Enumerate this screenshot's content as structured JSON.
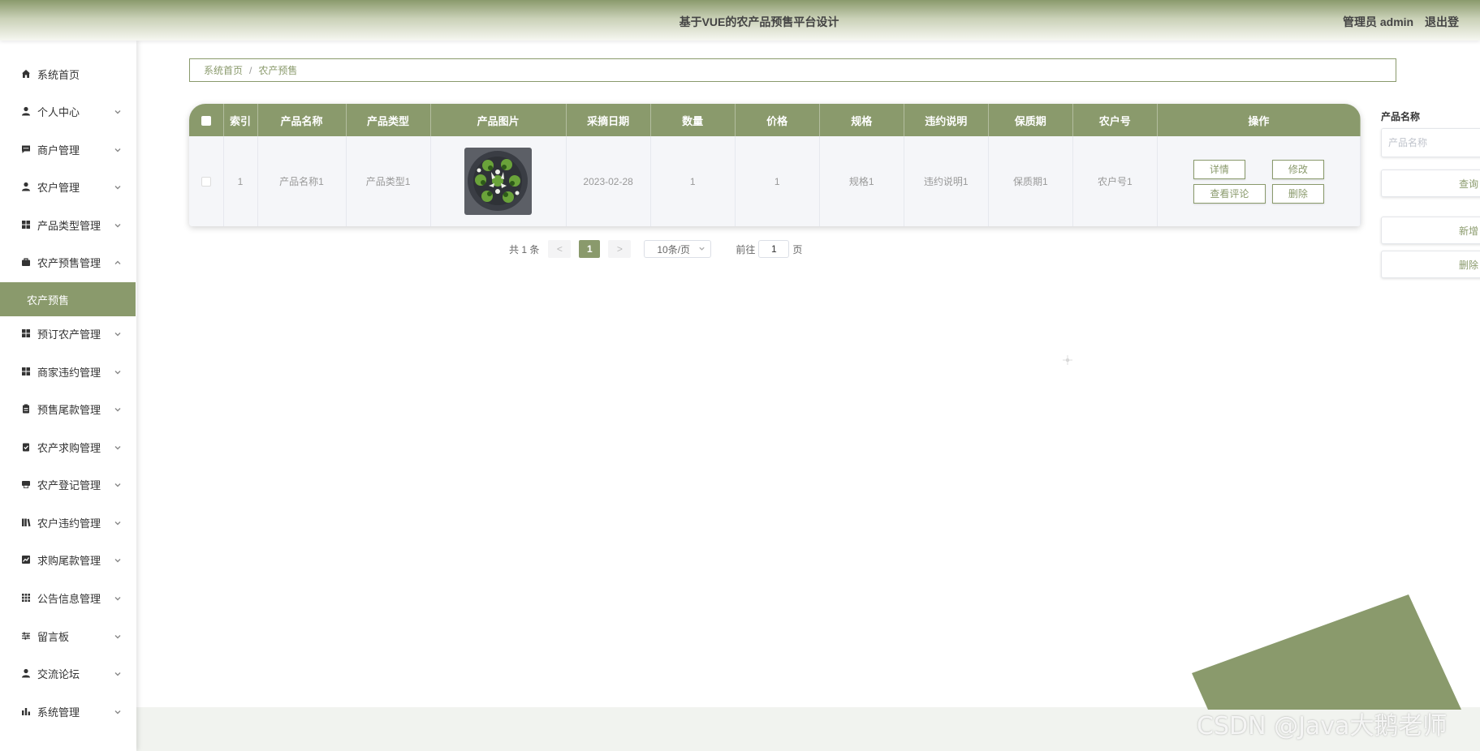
{
  "header": {
    "title": "基于VUE的农产品预售平台设计",
    "user_label": "管理员 admin",
    "logout_label": "退出登"
  },
  "sidebar": {
    "items": [
      {
        "label": "系统首页",
        "icon": "home-icon"
      },
      {
        "label": "个人中心",
        "icon": "user-icon"
      },
      {
        "label": "商户管理",
        "icon": "chat-icon"
      },
      {
        "label": "农户管理",
        "icon": "user-icon"
      },
      {
        "label": "产品类型管理",
        "icon": "grid-icon"
      },
      {
        "label": "农产预售管理",
        "icon": "briefcase-icon"
      },
      {
        "label": "预订农产管理",
        "icon": "grid-icon"
      },
      {
        "label": "商家违约管理",
        "icon": "grid-icon"
      },
      {
        "label": "预售尾款管理",
        "icon": "clipboard-icon"
      },
      {
        "label": "农产求购管理",
        "icon": "clipboard-check-icon"
      },
      {
        "label": "农产登记管理",
        "icon": "printer-icon"
      },
      {
        "label": "农户违约管理",
        "icon": "book-icon"
      },
      {
        "label": "求购尾款管理",
        "icon": "chart-line-icon"
      },
      {
        "label": "公告信息管理",
        "icon": "apps-icon"
      },
      {
        "label": "留言板",
        "icon": "sliders-icon"
      },
      {
        "label": "交流论坛",
        "icon": "user-icon"
      },
      {
        "label": "系统管理",
        "icon": "bar-chart-icon"
      }
    ],
    "active_sub": "农产预售"
  },
  "breadcrumb": {
    "home": "系统首页",
    "separator": "/",
    "current": "农产预售"
  },
  "table": {
    "columns": [
      "索引",
      "产品名称",
      "产品类型",
      "产品图片",
      "采摘日期",
      "数量",
      "价格",
      "规格",
      "违约说明",
      "保质期",
      "农户号",
      "操作"
    ],
    "rows": [
      {
        "index": "1",
        "product_name": "产品名称1",
        "product_type": "产品类型1",
        "pick_date": "2023-02-28",
        "quantity": "1",
        "price": "1",
        "spec": "规格1",
        "breach_note": "违约说明1",
        "shelf_life": "保质期1",
        "farmer_no": "农户号1",
        "actions": {
          "detail": "详情",
          "edit": "修改",
          "comments": "查看评论",
          "delete": "删除"
        }
      }
    ]
  },
  "pagination": {
    "total": "共 1 条",
    "prev": "<",
    "current_page": "1",
    "next": ">",
    "page_size": "10条/页",
    "goto_prefix": "前往",
    "goto_value": "1",
    "goto_suffix": "页"
  },
  "search": {
    "label": "产品名称",
    "placeholder": "产品名称",
    "query_button": "查询",
    "add_button": "新增",
    "delete_button": "删除"
  },
  "watermark": "CSDN @Java大鹅老师",
  "colors": {
    "accent": "#8a9a6c",
    "table_row_bg": "#f5f6f9"
  }
}
